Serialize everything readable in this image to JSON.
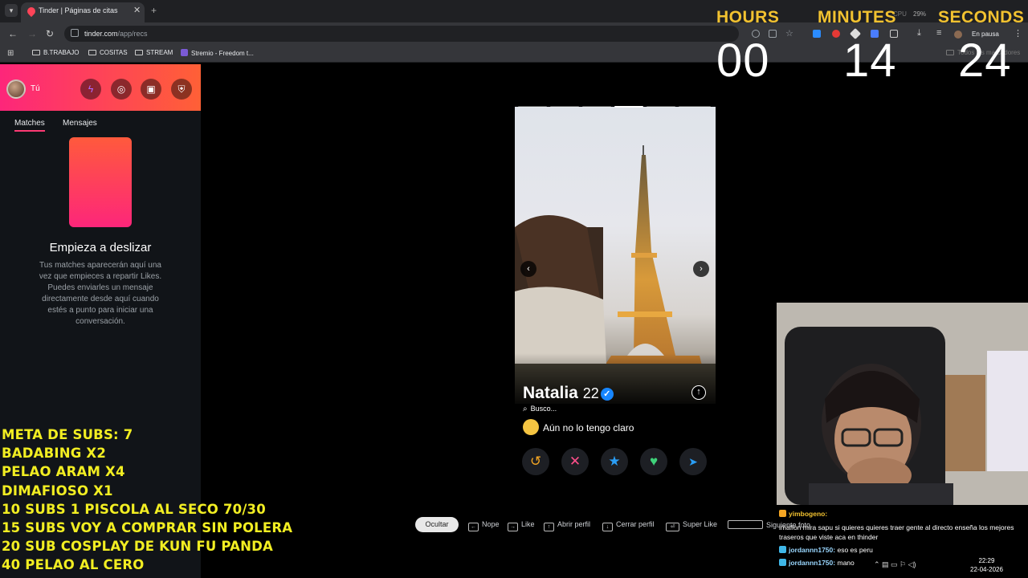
{
  "browser": {
    "tab_title": "Tinder | Páginas de citas",
    "url_host": "tinder.com",
    "url_path": "/app/recs",
    "profile_status": "En pausa",
    "all_bookmarks": "Todos los marcadores",
    "cpu_label": "CPU",
    "cpu_value": "29%",
    "bookmarks": [
      "B.TRABAJO",
      "COSITAS",
      "STREAM",
      "Stremio - Freedom t..."
    ]
  },
  "sidebar": {
    "me_label": "Tú",
    "tabs": [
      "Matches",
      "Mensajes"
    ],
    "empty_title": "Empieza a deslizar",
    "empty_desc": "Tus matches aparecerán aquí una vez que empieces a repartir Likes. Puedes enviarles un mensaje directamente desde aquí cuando estés a punto para iniciar una conversación."
  },
  "profile": {
    "name": "Natalia",
    "age": "22",
    "looking_label": "Busco...",
    "looking_value": "Aún no lo tengo claro",
    "photo_count": 6,
    "photo_index": 4
  },
  "hints": {
    "hide": "Ocultar",
    "items": [
      "Nope",
      "Like",
      "Abrir perfil",
      "Cerrar perfil",
      "Super Like",
      "Siguiente foto"
    ]
  },
  "timer": {
    "labels": [
      "HOURS",
      "MINUTES",
      "SECONDS"
    ],
    "values": [
      "00",
      "14",
      "24"
    ]
  },
  "goals": [
    "META DE SUBS:  7",
    "BADABING X2",
    "PELAO ARAM X4",
    "DIMAFIOSO X1",
    "10 SUBS 1 PISCOLA AL SECO 70/30",
    "15 SUBS VOY A COMPRAR SIN POLERA",
    "20 SUB COSPLAY DE KUN FU PANDA",
    "40 PELAO AL CERO"
  ],
  "chat": [
    {
      "user": "yimbogeno:",
      "text": ""
    },
    {
      "user": "",
      "text": "imafion mira sapu si quieres quieres traer gente al directo enseña los mejores traseros que viste aca en thinder"
    },
    {
      "user": "jordannn1750:",
      "text": "eso es peru"
    },
    {
      "user": "jordannn1750:",
      "text": "mano"
    }
  ],
  "taskbar": {
    "time": "22:29",
    "date": "22-04-2026"
  }
}
